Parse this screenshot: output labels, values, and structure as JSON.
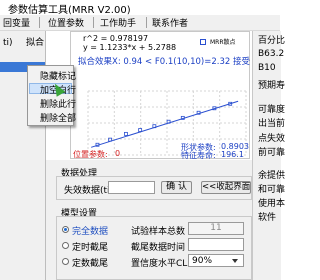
{
  "window": {
    "title": "参数估算工具(MRR V2.00)"
  },
  "menu": [
    "回变量",
    "位置参数",
    "工作助手",
    "联系作者"
  ],
  "left": {
    "tab_label": "ti)",
    "fit_button": "拟合"
  },
  "context_menu": {
    "items": [
      "隐藏标记",
      "加空白行",
      "删除此行",
      "删除全部"
    ],
    "hovered_index": 1
  },
  "plot": {
    "r2_line": "r^2 = 0.978197",
    "eq_line": "y = 1.1233*x + 5.2788",
    "fit_line": "拟合效果X: 0.94 < F0.1(10,10)=2.32 接受",
    "legend": "MRR散点",
    "shape_label": "形状参数:",
    "shape_value": "0.8903",
    "scale_label": "特征寿命:",
    "scale_value": "196.1",
    "location_label": "位置参数:",
    "location_value": "0",
    "points": [
      {
        "x": 0.06,
        "y": 0.16
      },
      {
        "x": 0.14,
        "y": 0.24
      },
      {
        "x": 0.24,
        "y": 0.33
      },
      {
        "x": 0.33,
        "y": 0.39
      },
      {
        "x": 0.42,
        "y": 0.45
      },
      {
        "x": 0.51,
        "y": 0.52
      },
      {
        "x": 0.6,
        "y": 0.58
      },
      {
        "x": 0.7,
        "y": 0.66
      },
      {
        "x": 0.8,
        "y": 0.73
      },
      {
        "x": 0.9,
        "y": 0.8
      }
    ]
  },
  "right_panel": [
    "百分比",
    "B63.2",
    "B10",
    "预期寿",
    "",
    "可靠度",
    "出当前",
    "点失效",
    "前可靠",
    "",
    "余提供",
    "和可靠",
    "使用本",
    "软件"
  ],
  "data_processing": {
    "title": "数据处理",
    "failure_label": "失效数据(ti)",
    "confirm_button": "确 认",
    "collapse_button": "<<收起界面"
  },
  "model": {
    "title": "模型设置",
    "radios": [
      "完全数据",
      "定时截尾",
      "定数截尾"
    ],
    "selected_index": 0,
    "sample_label": "试验样本总数",
    "sample_value": "11",
    "censor_time_label": "截尾数据时间",
    "censor_time_value": "",
    "confidence_label": "置信度水平CL",
    "confidence_value": "90%"
  }
}
